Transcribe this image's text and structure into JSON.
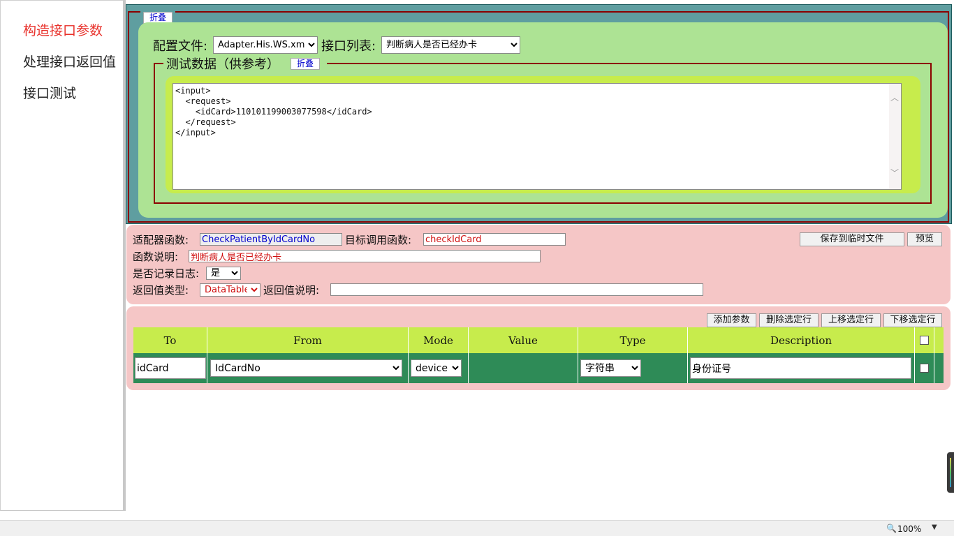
{
  "nav": {
    "items": [
      {
        "label": "构造接口参数",
        "active": true
      },
      {
        "label": "处理接口返回值",
        "active": false
      },
      {
        "label": "接口测试",
        "active": false
      }
    ]
  },
  "config": {
    "collapse_label": "折叠",
    "config_file_label": "配置文件:",
    "config_file_value": "Adapter.His.WS.xml",
    "interface_list_label": "接口列表:",
    "interface_list_value": "判断病人是否已经办卡",
    "test_data": {
      "legend": "测试数据（供参考）",
      "collapse_label": "折叠",
      "xml": "<input>\n  <request>\n    <idCard>110101199003077598</idCard>\n  </request>\n</input>"
    }
  },
  "function": {
    "adapter_label": "适配器函数:",
    "adapter_value": "CheckPatientByIdCardNo",
    "target_label": "目标调用函数:",
    "target_value": "checkIdCard",
    "desc_label": "函数说明:",
    "desc_value": "判断病人是否已经办卡",
    "log_label": "是否记录日志:",
    "log_value": "是",
    "return_type_label": "返回值类型:",
    "return_type_value": "DataTable",
    "return_desc_label": "返回值说明:",
    "return_desc_value": "",
    "save_button": "保存到临时文件",
    "preview_button": "预览"
  },
  "params": {
    "add_button": "添加参数",
    "delete_button": "删除选定行",
    "move_up_button": "上移选定行",
    "move_down_button": "下移选定行",
    "columns": [
      "To",
      "From",
      "Mode",
      "Value",
      "Type",
      "Description"
    ],
    "rows": [
      {
        "to": "idCard",
        "from": "IdCardNo",
        "mode": "device",
        "value": "",
        "type": "字符串",
        "description": "身份证号"
      }
    ]
  },
  "statusbar": {
    "zoom": "100%"
  },
  "colors": {
    "panel_teal": "#5f9ea0",
    "panel_green": "#ade394",
    "panel_lime": "#c7ec4c",
    "panel_pink": "#f5c6c6",
    "row_green": "#2e8b57",
    "border_red": "#8b0000",
    "active_red": "#e8302a",
    "link_blue": "#0000cd"
  }
}
